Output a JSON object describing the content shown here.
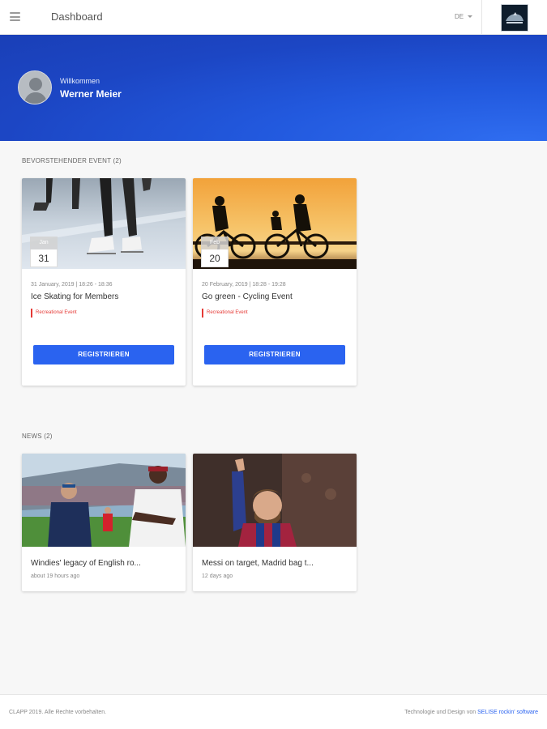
{
  "header": {
    "title": "Dashboard",
    "language": "DE"
  },
  "hero": {
    "welcome": "Willkommen",
    "name": "Werner Meier"
  },
  "events": {
    "section_title": "BEVORSTEHENDER EVENT (2)",
    "items": [
      {
        "month": "Jan",
        "day": "31",
        "time": "31 January, 2019 | 18:26 - 18:36",
        "title": "Ice Skating for Members",
        "tag": "Recreational Event",
        "button": "REGISTRIEREN",
        "image_icon": "ice-skating-photo"
      },
      {
        "month": "Feb",
        "day": "20",
        "time": "20 February, 2019 | 18:28 - 19:28",
        "title": "Go green - Cycling Event",
        "tag": "Recreational Event",
        "button": "REGISTRIEREN",
        "image_icon": "cycling-photo"
      }
    ]
  },
  "news": {
    "section_title": "NEWS (2)",
    "items": [
      {
        "title": "Windies' legacy of English ro...",
        "time": "about 19 hours ago",
        "image_icon": "cricket-photo"
      },
      {
        "title": "Messi on target, Madrid bag t...",
        "time": "12 days ago",
        "image_icon": "football-photo"
      }
    ]
  },
  "footer": {
    "copyright": "CLAPP 2019. Alle Rechte vorbehalten.",
    "credit_prefix": "Technologie und Design von",
    "credit_link": "SELISE rockin' software"
  },
  "colors": {
    "accent": "#2a63f0",
    "hero": "#1c46c4",
    "tag": "#e53935"
  }
}
